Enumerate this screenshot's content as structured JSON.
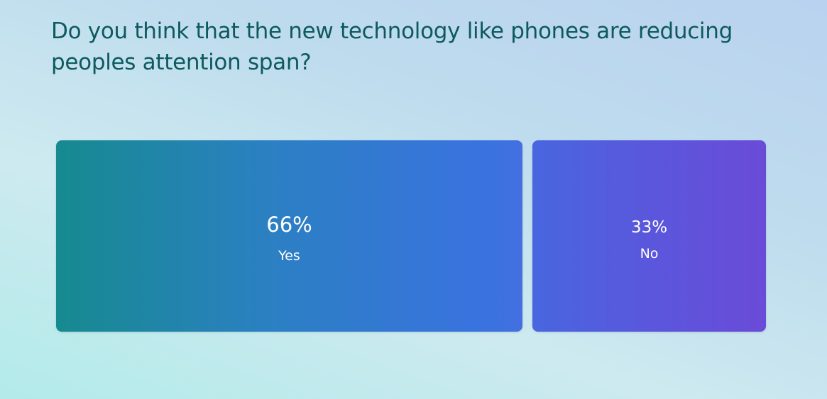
{
  "question": "Do you think that the new technology like phones are reducing peoples attention span?",
  "chart_data": {
    "type": "bar",
    "title": "Do you think that the new technology like phones are reducing peoples attention span?",
    "categories": [
      "Yes",
      "No"
    ],
    "values": [
      66,
      33
    ],
    "labels": [
      "66%",
      "33%"
    ],
    "unit": "%"
  },
  "colors": {
    "yes_start": "#168a8f",
    "yes_end": "#4470e0",
    "no_start": "#4866df",
    "no_end": "#6a4bd8",
    "title": "#0d5a5e"
  }
}
